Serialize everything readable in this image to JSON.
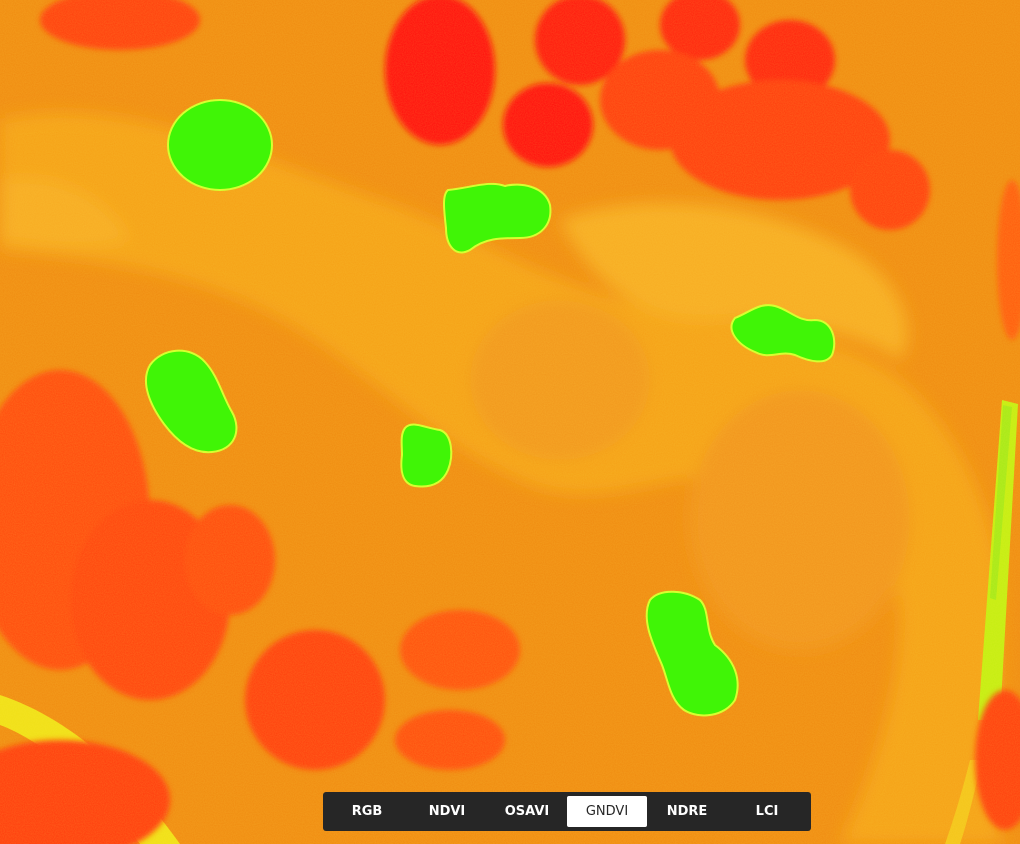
{
  "colors": {
    "background": "#f08a10",
    "high_index": "#3cf505",
    "low_index": "#ff1a0a",
    "toolbar_bg": "#262626",
    "active_tab_bg": "#ffffff"
  },
  "toolbar": {
    "active": "GNDVI",
    "tabs": [
      {
        "label": "RGB"
      },
      {
        "label": "NDVI"
      },
      {
        "label": "OSAVI"
      },
      {
        "label": "GNDVI"
      },
      {
        "label": "NDRE"
      },
      {
        "label": "LCI"
      }
    ]
  }
}
